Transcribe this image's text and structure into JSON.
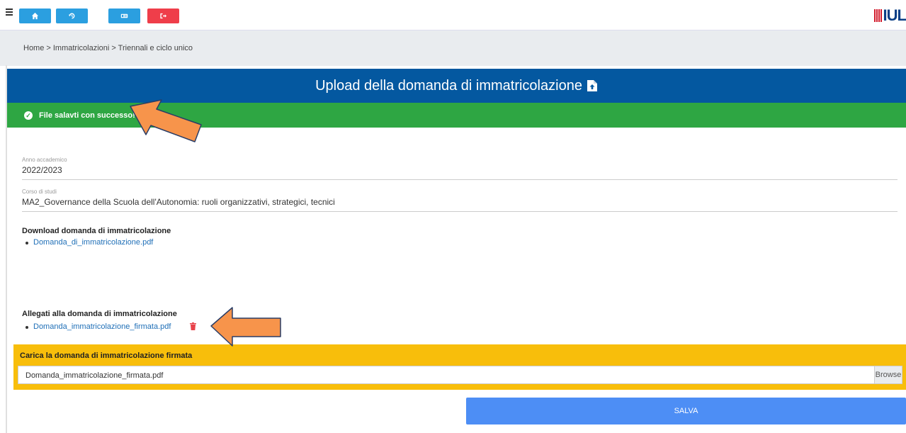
{
  "toolbar": {
    "buttons": [
      {
        "name": "home-button",
        "icon": "home-icon",
        "color": "#2b9fe0"
      },
      {
        "name": "history-button",
        "icon": "history-icon",
        "color": "#2b9fe0"
      },
      {
        "name": "id-card-button",
        "icon": "id-card-icon",
        "color": "#2b9fe0"
      },
      {
        "name": "logout-button",
        "icon": "logout-icon",
        "color": "#ef3e4a"
      }
    ]
  },
  "logo": {
    "text": "IUL"
  },
  "breadcrumb": {
    "text": "Home > Immatricolazioni > Triennali e ciclo unico"
  },
  "header": {
    "title": "Upload della domanda di immatricolazione"
  },
  "alert": {
    "text": "File salavti con successo!"
  },
  "fields": {
    "anno": {
      "label": "Anno accademico",
      "value": "2022/2023"
    },
    "corso": {
      "label": "Corso di studi",
      "value": "MA2_Governance della Scuola dell'Autonomia: ruoli organizzativi, strategici, tecnici"
    }
  },
  "download": {
    "title": "Download domanda di immatricolazione",
    "link": "Domanda_di_immatricolazione.pdf"
  },
  "allegati": {
    "title": "Allegati alla domanda di immatricolazione",
    "link": "Domanda_immatricolazione_firmata.pdf"
  },
  "upload": {
    "title": "Carica la domanda di immatricolazione firmata",
    "value": "Domanda_immatricolazione_firmata.pdf",
    "browse_label": "Browse"
  },
  "save": {
    "label": "SALVA"
  },
  "colors": {
    "header": "#0458a0",
    "success": "#2ea643",
    "upload": "#f8be0b",
    "save": "#4d8ef5",
    "arrow": "#f7944b"
  }
}
